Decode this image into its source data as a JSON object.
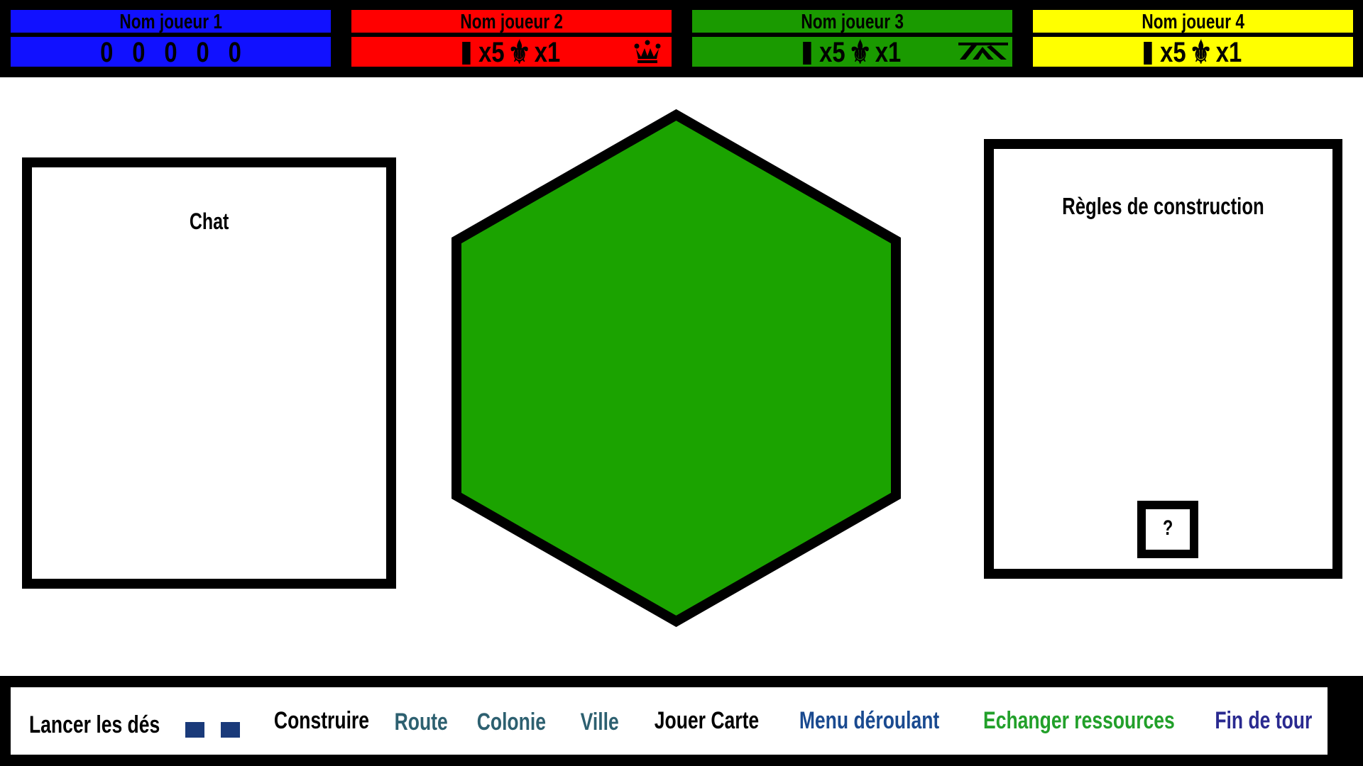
{
  "players": [
    {
      "name": "Nom joueur 1",
      "color": "#1111ff",
      "stats_type": "zeros",
      "zeros": [
        "0",
        "0",
        "0",
        "0",
        "0"
      ]
    },
    {
      "name": "Nom joueur 2",
      "color": "#ff0000",
      "stats_type": "cards",
      "cards": "x5",
      "points": "x1",
      "points_icon": "fleur-de-lis-icon",
      "badge": "crown-icon"
    },
    {
      "name": "Nom joueur 3",
      "color": "#1a9a00",
      "stats_type": "cards",
      "cards": "x5",
      "points": "x1",
      "points_icon": "fleur-de-lis-icon",
      "badge": "road-icon"
    },
    {
      "name": "Nom joueur 4",
      "color": "#ffff00",
      "stats_type": "cards",
      "cards": "x5",
      "points": "x1",
      "points_icon": "fleur-de-lis-icon",
      "badge": null
    }
  ],
  "chat": {
    "title": "Chat"
  },
  "board": {
    "tile_color": "#1ba300",
    "shape": "hexagon"
  },
  "rules": {
    "title": "Règles de construction",
    "help_label": "?"
  },
  "actions": {
    "roll_dice": "Lancer les dés",
    "dice_color": "#1a3a7a",
    "build": "Construire",
    "road": "Route",
    "settlement": "Colonie",
    "city": "Ville",
    "play_card": "Jouer Carte",
    "dropdown_menu": "Menu déroulant",
    "trade_resources": "Echanger ressources",
    "end_turn": "Fin de tour",
    "colors": {
      "roll_dice": "#000000",
      "build": "#000000",
      "road": "#2d6070",
      "settlement": "#2d6070",
      "city": "#2d6070",
      "play_card": "#000000",
      "dropdown_menu": "#1a4a90",
      "trade_resources": "#22a02a",
      "end_turn": "#2a2a90"
    }
  }
}
